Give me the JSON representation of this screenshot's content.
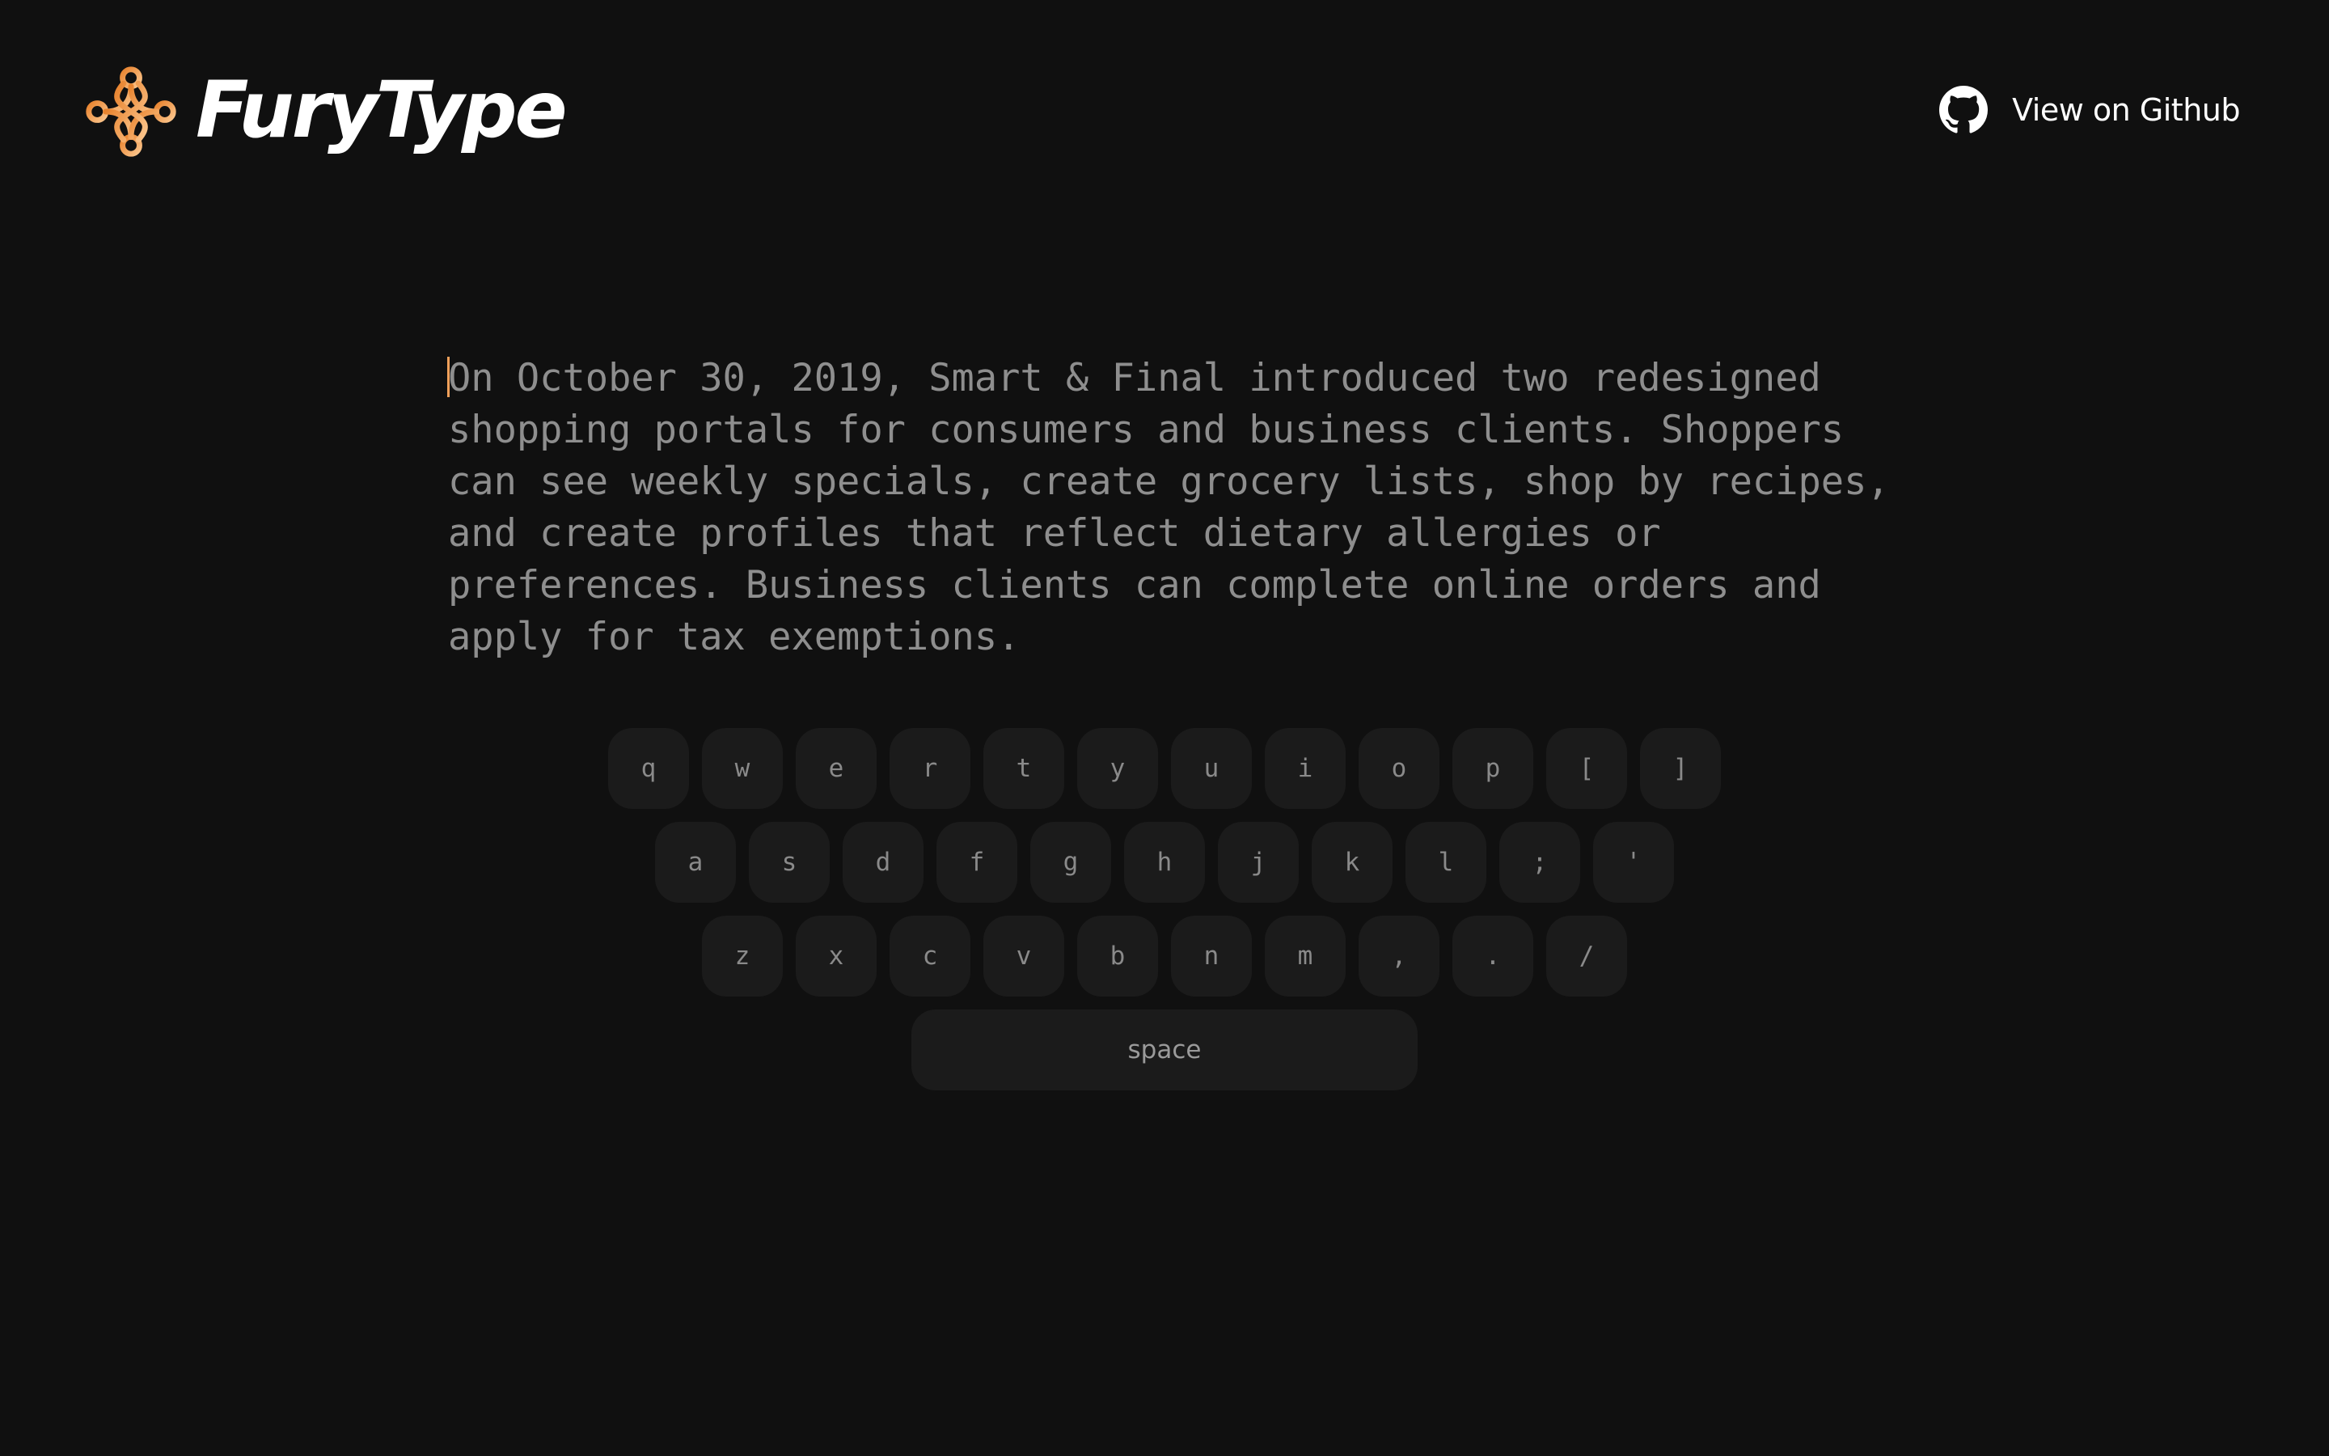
{
  "header": {
    "brand_name": "FuryType",
    "github_label": "View on Github",
    "logo_icon": "fury-knot-logo",
    "github_icon": "github-octocat-icon",
    "accent_color": "#f39a47"
  },
  "typing": {
    "first_char": "O",
    "remaining_text": "n October 30, 2019, Smart & Final introduced two redesigned shopping portals for consumers and business clients. Shoppers can see weekly specials, create grocery lists, shop by recipes, and create profiles that reflect dietary allergies or preferences. Business clients can complete online orders and apply for tax exemptions."
  },
  "keyboard": {
    "row1": [
      "q",
      "w",
      "e",
      "r",
      "t",
      "y",
      "u",
      "i",
      "o",
      "p",
      "[",
      "]"
    ],
    "row2": [
      "a",
      "s",
      "d",
      "f",
      "g",
      "h",
      "j",
      "k",
      "l",
      ";",
      "'"
    ],
    "row3": [
      "z",
      "x",
      "c",
      "v",
      "b",
      "n",
      "m",
      ",",
      ".",
      "/"
    ],
    "space_label": "space"
  }
}
